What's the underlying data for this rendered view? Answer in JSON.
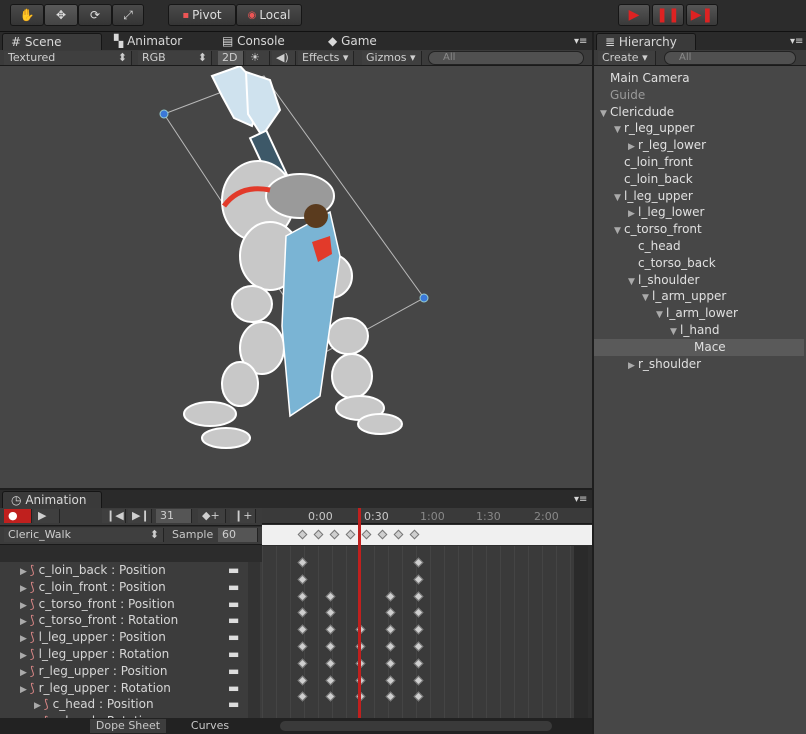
{
  "toolbar": {
    "tools": [
      "hand-icon",
      "move-icon",
      "rotate-icon",
      "scale-icon"
    ],
    "pivot_label": "Pivot",
    "local_label": "Local",
    "play_controls": [
      "play-icon",
      "pause-icon",
      "step-icon"
    ]
  },
  "scene_tabs": [
    {
      "label": "Scene",
      "icon": "grid-icon"
    },
    {
      "label": "Animator",
      "icon": "animator-icon"
    },
    {
      "label": "Console",
      "icon": "console-icon"
    },
    {
      "label": "Game",
      "icon": "game-icon"
    }
  ],
  "scene_toolbar": {
    "shading": "Textured",
    "render_mode": "RGB",
    "mode_2d": "2D",
    "effects": "Effects",
    "gizmos": "Gizmos",
    "search_placeholder": "All"
  },
  "hierarchy": {
    "title": "Hierarchy",
    "create_label": "Create",
    "search_placeholder": "All",
    "items": [
      {
        "label": "Main Camera",
        "depth": 0,
        "arrow": "",
        "style": "normal"
      },
      {
        "label": "Guide",
        "depth": 0,
        "arrow": "",
        "style": "dim"
      },
      {
        "label": "Clericdude",
        "depth": 0,
        "arrow": "open",
        "style": "normal"
      },
      {
        "label": "r_leg_upper",
        "depth": 1,
        "arrow": "open",
        "style": "normal"
      },
      {
        "label": "r_leg_lower",
        "depth": 2,
        "arrow": "closed",
        "style": "normal"
      },
      {
        "label": "c_loin_front",
        "depth": 1,
        "arrow": "",
        "style": "normal"
      },
      {
        "label": "c_loin_back",
        "depth": 1,
        "arrow": "",
        "style": "normal"
      },
      {
        "label": "l_leg_upper",
        "depth": 1,
        "arrow": "open",
        "style": "normal"
      },
      {
        "label": "l_leg_lower",
        "depth": 2,
        "arrow": "closed",
        "style": "normal"
      },
      {
        "label": "c_torso_front",
        "depth": 1,
        "arrow": "open",
        "style": "normal"
      },
      {
        "label": "c_head",
        "depth": 2,
        "arrow": "",
        "style": "normal"
      },
      {
        "label": "c_torso_back",
        "depth": 2,
        "arrow": "",
        "style": "normal"
      },
      {
        "label": "l_shoulder",
        "depth": 2,
        "arrow": "open",
        "style": "normal"
      },
      {
        "label": "l_arm_upper",
        "depth": 3,
        "arrow": "open",
        "style": "normal"
      },
      {
        "label": "l_arm_lower",
        "depth": 4,
        "arrow": "open",
        "style": "normal"
      },
      {
        "label": "l_hand",
        "depth": 5,
        "arrow": "open",
        "style": "normal"
      },
      {
        "label": "Mace",
        "depth": 6,
        "arrow": "",
        "style": "selected"
      },
      {
        "label": "r_shoulder",
        "depth": 2,
        "arrow": "closed",
        "style": "normal"
      }
    ]
  },
  "animation": {
    "title": "Animation",
    "frame": "31",
    "clip": "Cleric_Walk",
    "sample_label": "Sample",
    "sample_value": "60",
    "ruler": [
      "0:00",
      "0:30",
      "1:00",
      "1:30",
      "2:00"
    ],
    "properties": [
      {
        "label": "c_loin_back : Position",
        "indent": 0
      },
      {
        "label": "c_loin_front : Position",
        "indent": 0
      },
      {
        "label": "c_torso_front : Position",
        "indent": 0
      },
      {
        "label": "c_torso_front : Rotation",
        "indent": 0
      },
      {
        "label": "l_leg_upper : Position",
        "indent": 0
      },
      {
        "label": "l_leg_upper : Rotation",
        "indent": 0
      },
      {
        "label": "r_leg_upper : Position",
        "indent": 0
      },
      {
        "label": "r_leg_upper : Rotation",
        "indent": 0
      },
      {
        "label": "c_head : Position",
        "indent": 1
      },
      {
        "label": "c_head : Rotation",
        "indent": 1
      }
    ],
    "bottom_tabs": [
      "Dope Sheet",
      "Curves"
    ],
    "colors": {
      "playhead": "#c0201e",
      "record": "#c0201e"
    }
  }
}
